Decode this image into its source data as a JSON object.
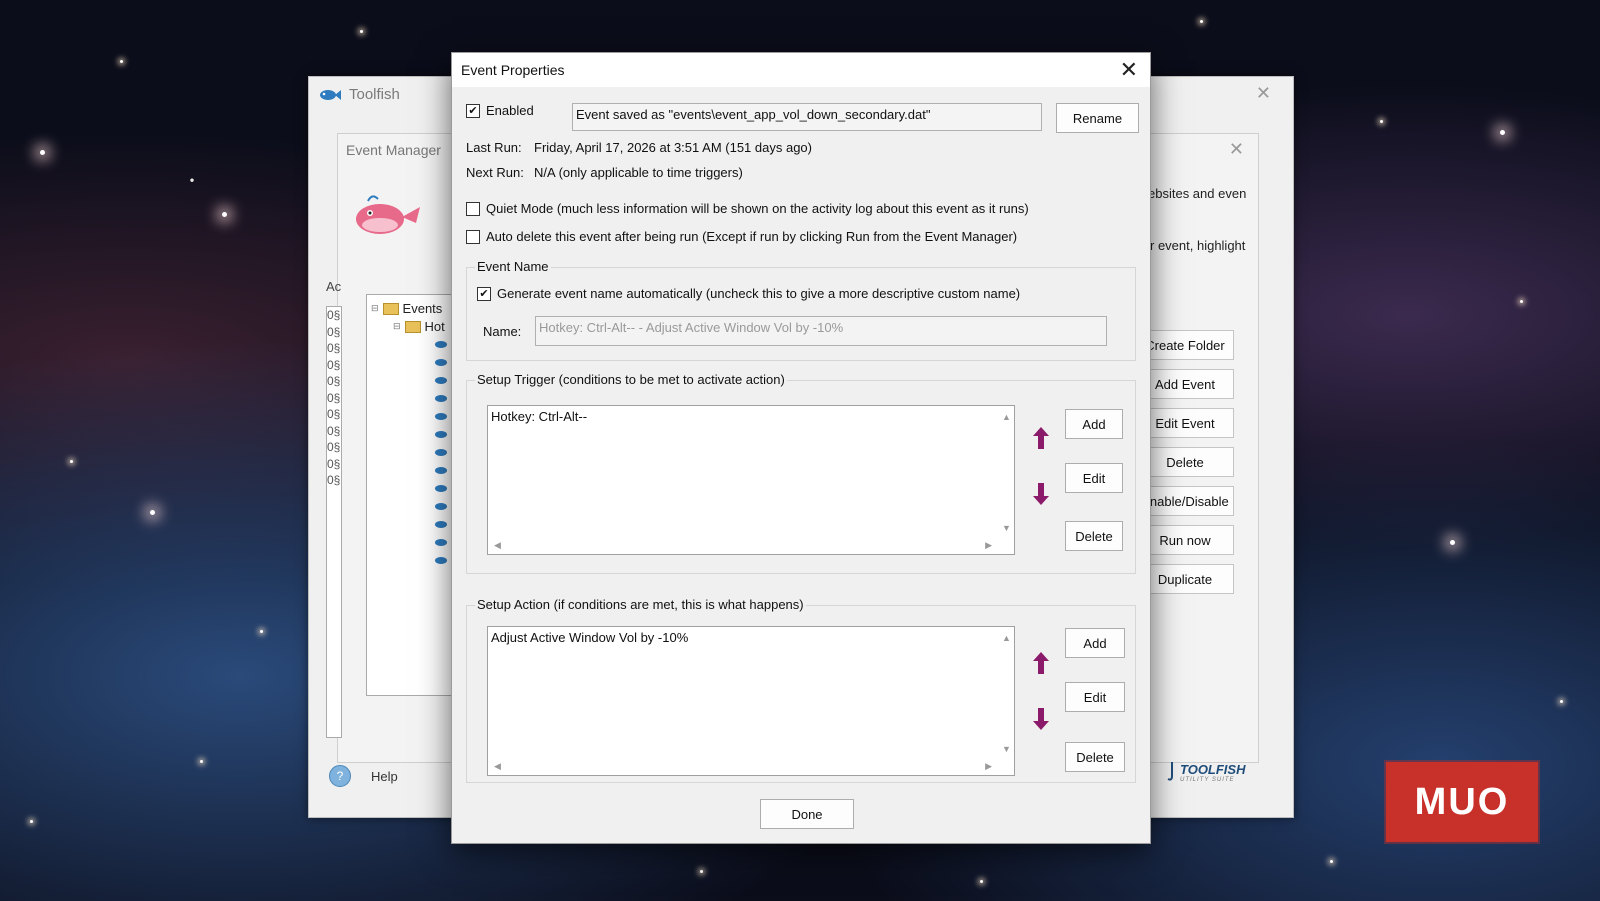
{
  "bg_window": {
    "app_title": "Toolfish",
    "event_manager_title": "Event Manager",
    "ac_label": "Ac",
    "tree": {
      "root": "Events",
      "child": "Hot"
    },
    "list_prefix": [
      "0§",
      "0§",
      "0§",
      "0§",
      "0§",
      "0§",
      "0§",
      "0§",
      "0§",
      "0§",
      "0§"
    ],
    "right_text_1": "ebsites and even",
    "right_text_2": "r event, highlight",
    "buttons": [
      "Create Folder",
      "Add Event",
      "Edit Event",
      "Delete",
      "Enable/Disable",
      "Run now",
      "Duplicate"
    ],
    "help_label": "Help",
    "logo_text": "TOOLFISH",
    "logo_sub": "UTILITY SUITE"
  },
  "dialog": {
    "title": "Event Properties",
    "enabled_label": "Enabled",
    "enabled_checked": true,
    "saved_as": "Event saved as \"events\\event_app_vol_down_secondary.dat\"",
    "rename_label": "Rename",
    "last_run_label": "Last Run:",
    "last_run_value": "Friday, April 17, 2026 at  3:51 AM (151 days ago)",
    "next_run_label": "Next Run:",
    "next_run_value": "N/A (only applicable to time triggers)",
    "quiet_mode_label": "Quiet Mode (much less information will be shown on the activity log about this event as it runs)",
    "quiet_mode_checked": false,
    "auto_delete_label": "Auto delete this event after being run (Except if run by clicking Run from the Event Manager)",
    "auto_delete_checked": false,
    "event_name_group": "Event Name",
    "generate_label": "Generate event name automatically (uncheck this to give a more descriptive custom  name)",
    "generate_checked": true,
    "name_label": "Name:",
    "name_value": "Hotkey: Ctrl-Alt-- - Adjust Active Window Vol by -10%",
    "trigger_group": "Setup Trigger (conditions to be met to activate action)",
    "trigger_items": [
      "Hotkey: Ctrl-Alt--"
    ],
    "trigger_add": "Add",
    "trigger_edit": "Edit",
    "trigger_delete": "Delete",
    "action_group": "Setup Action (if conditions are met, this is what happens)",
    "action_items": [
      "Adjust Active Window Vol by -10%"
    ],
    "action_add": "Add",
    "action_edit": "Edit",
    "action_delete": "Delete",
    "done_label": "Done"
  },
  "watermark": "MUO",
  "colors": {
    "move_arrow": "#8b1a6b",
    "muo_red": "#c8302a"
  }
}
